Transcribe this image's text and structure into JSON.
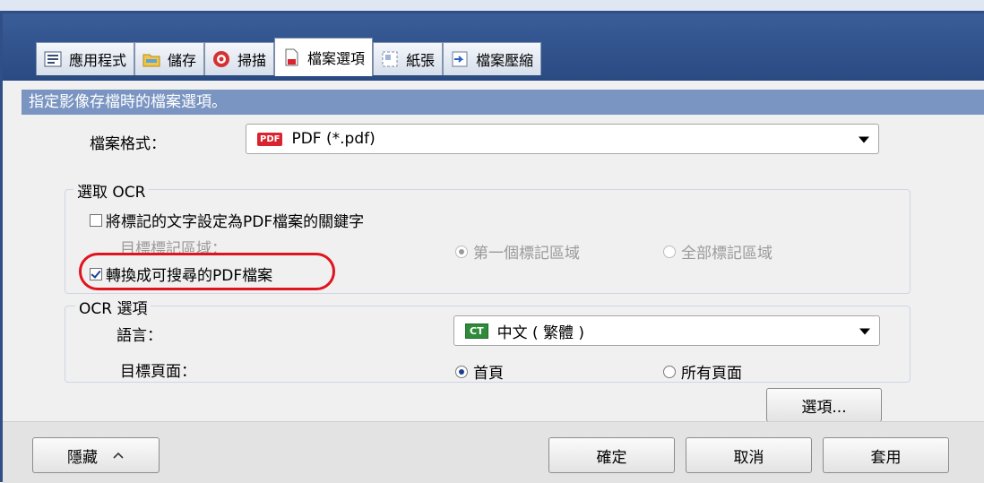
{
  "tabs": [
    {
      "label": "應用程式",
      "icon": "app-list-icon"
    },
    {
      "label": "儲存",
      "icon": "folder-icon"
    },
    {
      "label": "掃描",
      "icon": "scan-icon"
    },
    {
      "label": "檔案選項",
      "icon": "file-icon"
    },
    {
      "label": "紙張",
      "icon": "paper-icon"
    },
    {
      "label": "檔案壓縮",
      "icon": "compress-icon"
    }
  ],
  "header_text": "指定影像存檔時的檔案選項。",
  "file_format": {
    "label": "檔案格式：",
    "badge": "PDF",
    "value": "PDF (*.pdf)"
  },
  "ocr_group": {
    "title": "選取 OCR",
    "keyword_checkbox": {
      "label": "將標記的文字設定為PDF檔案的關鍵字",
      "checked": false
    },
    "target_area_label": "目標標記區域：",
    "first_area_option": "第一個標記區域",
    "all_areas_option": "全部標記區域",
    "searchable_checkbox": {
      "label": "轉換成可搜尋的PDF檔案",
      "checked": true
    }
  },
  "ocr_options": {
    "title": "OCR 選項",
    "language_label": "語言：",
    "language_badge": "CT",
    "language_value": "中文 ( 繁體 )",
    "target_page_label": "目標頁面：",
    "first_page_option": "首頁",
    "all_pages_option": "所有頁面",
    "options_button": "選項..."
  },
  "footer": {
    "hide_button": "隱藏",
    "ok_button": "確定",
    "cancel_button": "取消",
    "apply_button": "套用"
  },
  "colors": {
    "header_bar": "#7b95c2",
    "highlight": "#e0141e",
    "title_bar": "#2f4f86"
  }
}
